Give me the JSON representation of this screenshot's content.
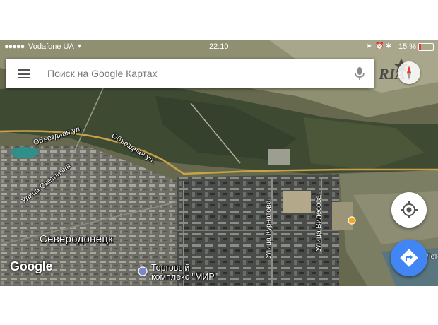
{
  "status_bar": {
    "signal": "●●●●●",
    "carrier": "Vodafone UA",
    "time": "22:10",
    "battery": "15 %"
  },
  "search": {
    "placeholder": "Поиск на Google Картах"
  },
  "watermark": {
    "text": "RIA"
  },
  "map": {
    "labels": {
      "road_1": "Объездная ул.",
      "road_2": "Объездная ул.",
      "street_svetlichnogo": "Улица Светлична",
      "street_kurchatova": "Улица Курчатова",
      "street_vilesova": "Улица Вилесова",
      "city": "Северодонецк",
      "poi_line1": "Торговый",
      "poi_line2": "комплекс \"МИР\"",
      "edge": "Лето"
    },
    "logo": "Google"
  },
  "colors": {
    "accent_blue": "#4285f4",
    "road": "#c9a24a"
  }
}
